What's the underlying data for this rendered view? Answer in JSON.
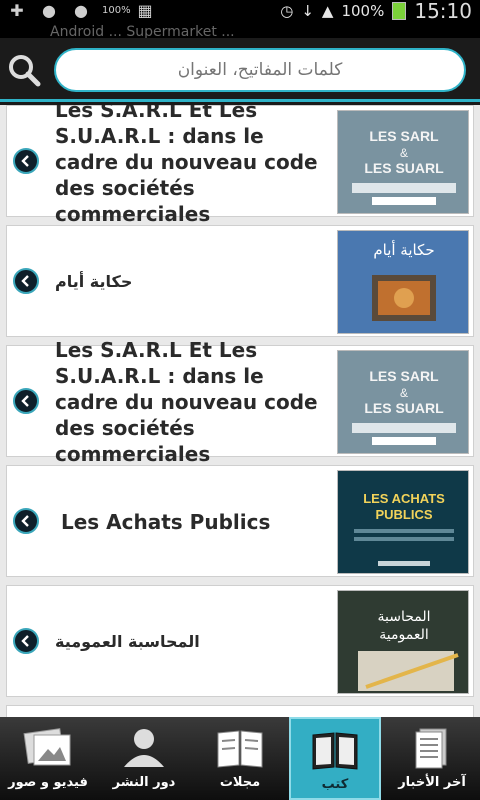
{
  "statusbar": {
    "icons": [
      "plus-icon",
      "messenger-icon",
      "messenger-icon",
      "progress-icon",
      "app-icon"
    ],
    "progress_label": "100%",
    "battery": "100%",
    "time": "15:10",
    "ticker": "Android ... Supermarket ..."
  },
  "search": {
    "placeholder": "كلمات المفاتيح، العنوان"
  },
  "books": [
    {
      "title": "Les S.A.R.L Et Les S.U.A.R.L : dans le cadre du nouveau code des sociétés commerciales",
      "lang": "fr",
      "cover_color": "#6a8494",
      "cover_text": "LES SARL & LES SUARL"
    },
    {
      "title": "حكاية أيام",
      "lang": "ar",
      "cover_color": "#3d6ea8",
      "cover_text": "حكاية أيام"
    },
    {
      "title": "Les S.A.R.L Et Les S.U.A.R.L : dans le cadre du nouveau code des sociétés commerciales",
      "lang": "fr",
      "cover_color": "#6a8494",
      "cover_text": "LES SARL & LES SUARL"
    },
    {
      "title": "Les Achats Publics",
      "lang": "fr",
      "cover_color": "#0f3948",
      "cover_text": "LES ACHATS PUBLICS"
    },
    {
      "title": "المحاسبة العمومية",
      "lang": "ar",
      "cover_color": "#2f3b32",
      "cover_text": "المحاسبة العمومية"
    }
  ],
  "tabs": [
    {
      "label": "فيديو و صور",
      "icon": "photo-icon"
    },
    {
      "label": "دور النشر",
      "icon": "person-icon"
    },
    {
      "label": "مجلات",
      "icon": "magazine-icon"
    },
    {
      "label": "كتب",
      "icon": "book-icon",
      "active": true
    },
    {
      "label": "آخر الأخبار",
      "icon": "news-icon"
    }
  ],
  "colors": {
    "accent": "#33aec4",
    "arrow_bg": "#0e1f2a"
  }
}
